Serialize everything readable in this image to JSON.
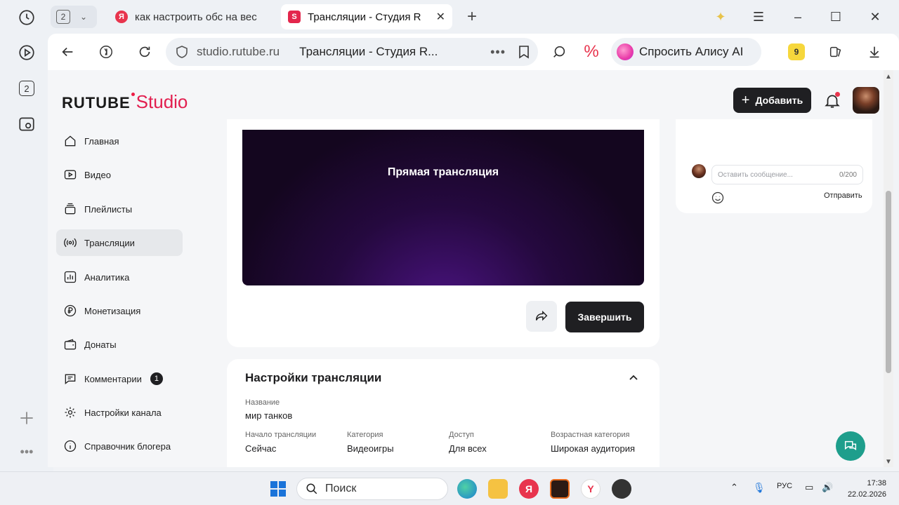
{
  "browser": {
    "tab_count": "2",
    "tabs": [
      {
        "title": "как настроить обс на вес",
        "favicon": "Я"
      },
      {
        "title": "Трансляции - Студия R",
        "favicon": "S"
      }
    ],
    "address": {
      "domain": "studio.rutube.ru",
      "page_title": "Трансляции - Студия R..."
    },
    "alice_label": "Спросить Алису AI",
    "rail_tab_count": "2"
  },
  "header": {
    "logo_main": "RUTUBE",
    "logo_studio": "Studio",
    "add_button": "Добавить"
  },
  "sidebar": {
    "items": [
      {
        "label": "Главная",
        "icon": "home-icon"
      },
      {
        "label": "Видео",
        "icon": "video-icon"
      },
      {
        "label": "Плейлисты",
        "icon": "playlist-icon"
      },
      {
        "label": "Трансляции",
        "icon": "broadcast-icon"
      },
      {
        "label": "Аналитика",
        "icon": "analytics-icon"
      },
      {
        "label": "Монетизация",
        "icon": "ruble-icon"
      },
      {
        "label": "Донаты",
        "icon": "wallet-icon"
      },
      {
        "label": "Комментарии",
        "icon": "comment-icon",
        "badge": "1"
      },
      {
        "label": "Настройки канала",
        "icon": "gear-icon"
      },
      {
        "label": "Справочник блогера",
        "icon": "info-icon"
      }
    ],
    "active_index": 3
  },
  "player": {
    "title": "Прямая трансляция",
    "finish_button": "Завершить"
  },
  "settings": {
    "title": "Настройки трансляции",
    "name_label": "Название",
    "name_value": "мир танков",
    "fields": [
      {
        "label": "Начало трансляции",
        "value": "Сейчас"
      },
      {
        "label": "Категория",
        "value": "Видеоигры"
      },
      {
        "label": "Доступ",
        "value": "Для всех"
      },
      {
        "label": "Возрастная категория",
        "value": "Широкая аудитория"
      }
    ]
  },
  "chat": {
    "placeholder": "Оставить сообщение...",
    "counter": "0/200",
    "send_label": "Отправить"
  },
  "taskbar": {
    "search_label": "Поиск",
    "language": "РУС",
    "time": "17:38",
    "date": "22.02.2026"
  },
  "colors": {
    "brand_red": "#e21f4f",
    "dark_button": "#1f1f22",
    "support_teal": "#1e9e8c"
  }
}
